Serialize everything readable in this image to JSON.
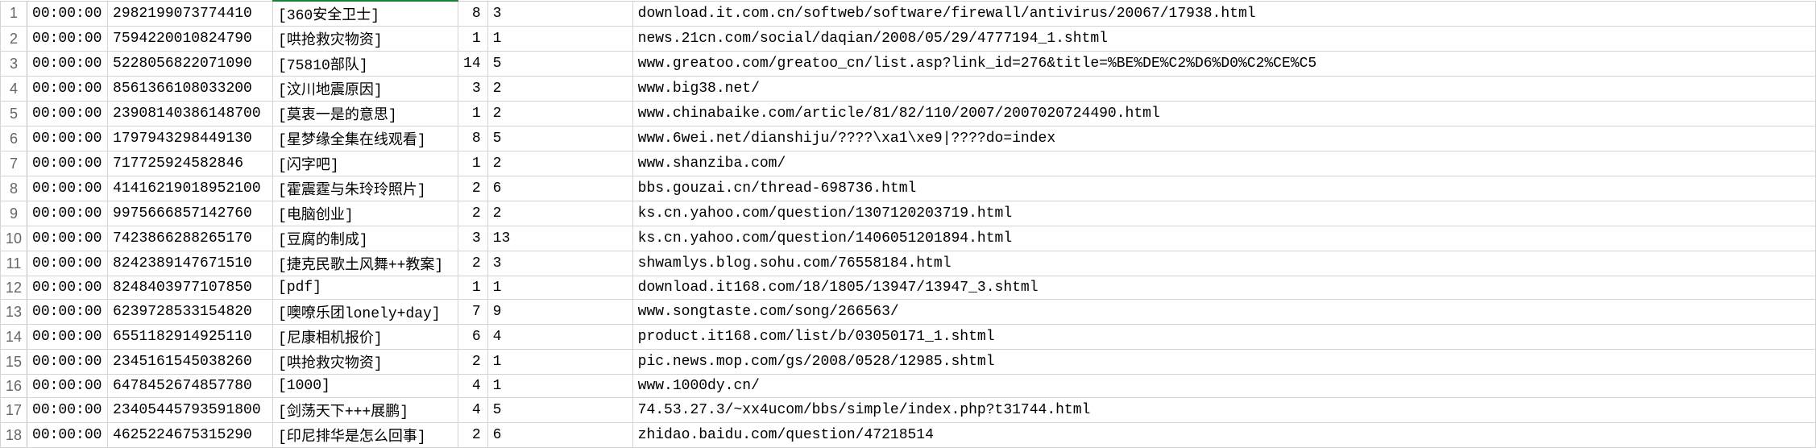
{
  "rows": [
    {
      "n": "1",
      "b": "00:00:00",
      "c": "2982199073774410",
      "d": "[360安全卫士]",
      "e": "8",
      "f": "3",
      "g": "download.it.com.cn/softweb/software/firewall/antivirus/20067/17938.html"
    },
    {
      "n": "2",
      "b": "00:00:00",
      "c": "7594220010824790",
      "d": "[哄抢救灾物资]",
      "e": "1",
      "f": "1",
      "g": "news.21cn.com/social/daqian/2008/05/29/4777194_1.shtml"
    },
    {
      "n": "3",
      "b": "00:00:00",
      "c": "5228056822071090",
      "d": "[75810部队]",
      "e": "14",
      "f": "5",
      "g": "www.greatoo.com/greatoo_cn/list.asp?link_id=276&title=%BE%DE%C2%D6%D0%C2%CE%C5"
    },
    {
      "n": "4",
      "b": "00:00:00",
      "c": "8561366108033200",
      "d": "[汶川地震原因]",
      "e": "3",
      "f": "2",
      "g": "www.big38.net/"
    },
    {
      "n": "5",
      "b": "00:00:00",
      "c": "23908140386148700",
      "d": "[莫衷一是的意思]",
      "e": "1",
      "f": "2",
      "g": "www.chinabaike.com/article/81/82/110/2007/2007020724490.html"
    },
    {
      "n": "6",
      "b": "00:00:00",
      "c": "1797943298449130",
      "d": "[星梦缘全集在线观看]",
      "e": "8",
      "f": "5",
      "g": "www.6wei.net/dianshiju/????\\xa1\\xe9|????do=index"
    },
    {
      "n": "7",
      "b": "00:00:00",
      "c": "717725924582846",
      "d": "[闪字吧]",
      "e": "1",
      "f": "2",
      "g": "www.shanziba.com/"
    },
    {
      "n": "8",
      "b": "00:00:00",
      "c": "41416219018952100",
      "d": "[霍震霆与朱玲玲照片]",
      "e": "2",
      "f": "6",
      "g": "bbs.gouzai.cn/thread-698736.html"
    },
    {
      "n": "9",
      "b": "00:00:00",
      "c": "9975666857142760",
      "d": "[电脑创业]",
      "e": "2",
      "f": "2",
      "g": "ks.cn.yahoo.com/question/1307120203719.html"
    },
    {
      "n": "10",
      "b": "00:00:00",
      "c": "7423866288265170",
      "d": "[豆腐的制成]",
      "e": "3",
      "f": "13",
      "g": "ks.cn.yahoo.com/question/1406051201894.html"
    },
    {
      "n": "11",
      "b": "00:00:00",
      "c": "8242389147671510",
      "d": "[捷克民歌土风舞++教案]",
      "e": "2",
      "f": "3",
      "g": "shwamlys.blog.sohu.com/76558184.html"
    },
    {
      "n": "12",
      "b": "00:00:00",
      "c": "8248403977107850",
      "d": "[pdf]",
      "e": "1",
      "f": "1",
      "g": "download.it168.com/18/1805/13947/13947_3.shtml"
    },
    {
      "n": "13",
      "b": "00:00:00",
      "c": "6239728533154820",
      "d": "[噢嘹乐团lonely+day]",
      "e": "7",
      "f": "9",
      "g": "www.songtaste.com/song/266563/"
    },
    {
      "n": "14",
      "b": "00:00:00",
      "c": "6551182914925110",
      "d": "[尼康相机报价]",
      "e": "6",
      "f": "4",
      "g": "product.it168.com/list/b/03050171_1.shtml"
    },
    {
      "n": "15",
      "b": "00:00:00",
      "c": "2345161545038260",
      "d": "[哄抢救灾物资]",
      "e": "2",
      "f": "1",
      "g": "pic.news.mop.com/gs/2008/0528/12985.shtml"
    },
    {
      "n": "16",
      "b": "00:00:00",
      "c": "6478452674857780",
      "d": "[1000]",
      "e": "4",
      "f": "1",
      "g": "www.1000dy.cn/"
    },
    {
      "n": "17",
      "b": "00:00:00",
      "c": "23405445793591800",
      "d": "[剑荡天下+++展鹏]",
      "e": "4",
      "f": "5",
      "g": "74.53.27.3/~xx4ucom/bbs/simple/index.php?t31744.html"
    },
    {
      "n": "18",
      "b": "00:00:00",
      "c": "4625224675315290",
      "d": "[印尼排华是怎么回事]",
      "e": "2",
      "f": "6",
      "g": "zhidao.baidu.com/question/47218514"
    }
  ]
}
